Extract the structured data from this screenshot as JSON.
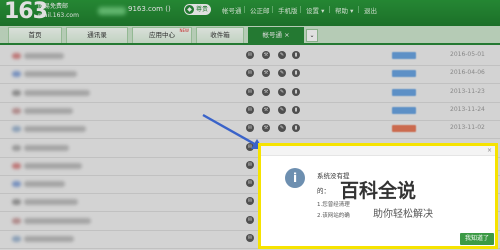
{
  "header": {
    "logo": "163",
    "logo_sub1": "网易免费邮",
    "logo_sub2": "mail.163.com",
    "account": "9163.com ()",
    "vip_label": "尊贵",
    "nav": [
      "帐号通",
      "公正邮",
      "手机版",
      "设置 ▾",
      "帮助 ▾",
      "退出"
    ]
  },
  "tabs": [
    {
      "label": "首页"
    },
    {
      "label": "通讯录"
    },
    {
      "label": "应用中心",
      "hot": "NEW"
    },
    {
      "label": "收件箱"
    },
    {
      "label": "帐号通",
      "close": "×",
      "active": true
    }
  ],
  "tab_more": "⌄",
  "rows": [
    {
      "tag_color": "#6aa4e2",
      "date": "2016-05-01"
    },
    {
      "tag_color": "#6aa4e2",
      "date": "2016-04-06"
    },
    {
      "tag_color": "#6aa4e2",
      "date": "2013-11-23"
    },
    {
      "tag_color": "#6aa4e2",
      "date": "2013-11-24"
    },
    {
      "tag_color": "#e87a5a",
      "date": "2013-11-02"
    },
    {
      "tag_color": "",
      "date": "2013-11-03"
    },
    {
      "tag_color": "",
      "date": ""
    },
    {
      "tag_color": "",
      "date": ""
    },
    {
      "tag_color": "",
      "date": ""
    },
    {
      "tag_color": "",
      "date": ""
    },
    {
      "tag_color": "",
      "date": ""
    }
  ],
  "dialog": {
    "line1": "系统没有提",
    "line2": "的：",
    "line3": "1.您曾经清理",
    "line4": "2.该网站的确",
    "ok_label": "我知道了",
    "close": "×"
  },
  "watermark": {
    "main": "百科全说",
    "sub": "助你轻松解决"
  },
  "colors": {
    "header_green": "#2a8a39",
    "dialog_border": "#f6e300",
    "arrow_blue": "#3a63c9"
  }
}
